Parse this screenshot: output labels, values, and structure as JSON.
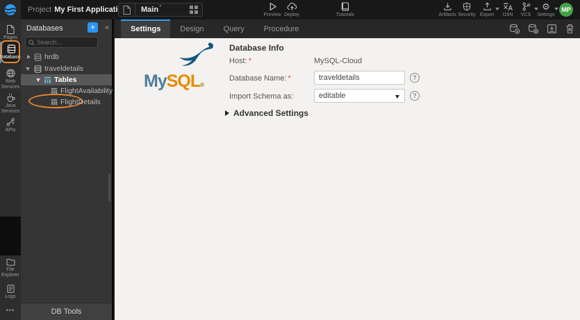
{
  "topbar": {
    "project_label": "Project",
    "project_name": "My First Application",
    "breadcrumb_chevron": "›",
    "page_name": "Main",
    "dirty_marker": "*",
    "preview": "Preview",
    "deploy": "Deploy",
    "tutorials": "Tutorials",
    "artifacts": "Artifacts",
    "security": "Security",
    "export": "Export",
    "i18n": "I18N",
    "vcs": "VCS",
    "settings": "Settings",
    "avatar_initials": "MP"
  },
  "sidebar": {
    "items": [
      {
        "label": "Pages"
      },
      {
        "label": "Databases",
        "active": true
      },
      {
        "label": "Web Services"
      },
      {
        "label": "Java Services"
      },
      {
        "label": "APIs"
      }
    ],
    "bottom_items": [
      {
        "label": "File Explorer"
      },
      {
        "label": "Logs"
      },
      {
        "label": "•••"
      }
    ]
  },
  "panel": {
    "title": "Databases",
    "add_button": "+",
    "collapse_button": "«",
    "search_placeholder": "Search...",
    "tree": [
      {
        "label": "hrdb",
        "type": "database",
        "state": "collapsed"
      },
      {
        "label": "traveldetails",
        "type": "database",
        "state": "expanded",
        "annotated": true
      },
      {
        "label": "Tables",
        "type": "tables-folder",
        "state": "expanded",
        "selected": true
      },
      {
        "label": "FlightAvailability",
        "type": "table"
      },
      {
        "label": "FlightDetails",
        "type": "table"
      }
    ],
    "footer": "DB Tools"
  },
  "main": {
    "tabs": [
      {
        "label": "Settings",
        "active": true
      },
      {
        "label": "Design"
      },
      {
        "label": "Query"
      },
      {
        "label": "Procedure"
      }
    ],
    "logo": {
      "my": "My",
      "sql": "SQL",
      "registered": "®"
    },
    "form": {
      "section_title": "Database Info",
      "required_marker": "*",
      "host_label": "Host:",
      "host_value": "MySQL-Cloud",
      "db_name_label": "Database Name:",
      "db_name_value": "traveldetails",
      "import_label": "Import Schema as:",
      "import_value": "editable",
      "advanced_label": "Advanced Settings",
      "help_glyph": "?"
    }
  },
  "icons": {
    "gear": "⚙"
  },
  "colors": {
    "accent_blue": "#2d9bf0",
    "annotation_orange": "#e8872b",
    "avatar_green": "#45a049",
    "mysql_blue": "#4e7e9c",
    "mysql_orange": "#e78b00",
    "required_red": "#e5433c",
    "content_bg": "#f4f2f0",
    "panel_bg": "#353535",
    "topbar_bg": "#181818"
  }
}
